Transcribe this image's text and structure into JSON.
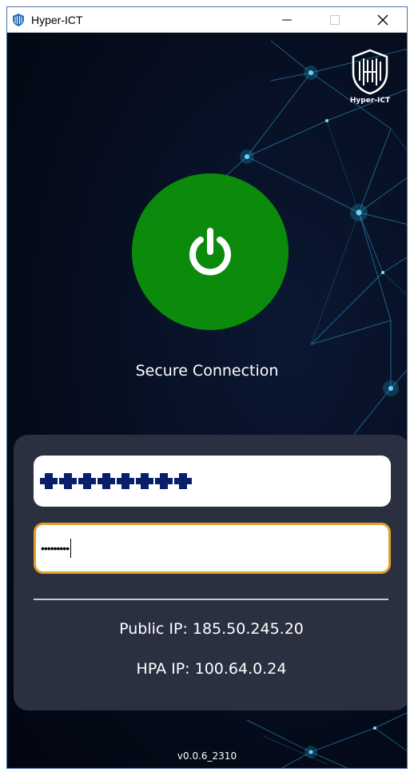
{
  "window": {
    "title": "Hyper-ICT",
    "minimize_glyph": "—",
    "maximize_glyph": "☐",
    "close_glyph": "✕"
  },
  "logo": {
    "text": "Hyper-ICT",
    "icon": "hyper-ict-shield-logo"
  },
  "power": {
    "icon": "power-icon",
    "color": "#0b8a0b",
    "state": "connected"
  },
  "status": {
    "text": "Secure Connection"
  },
  "login": {
    "username_value": "(redacted)",
    "password_masked": "•••••••••",
    "focus_color": "#e2a22a"
  },
  "info": {
    "public_ip": "Public IP: 185.50.245.20",
    "hpa_ip": "HPA IP: 100.64.0.24"
  },
  "version": "v0.0.6_2310"
}
